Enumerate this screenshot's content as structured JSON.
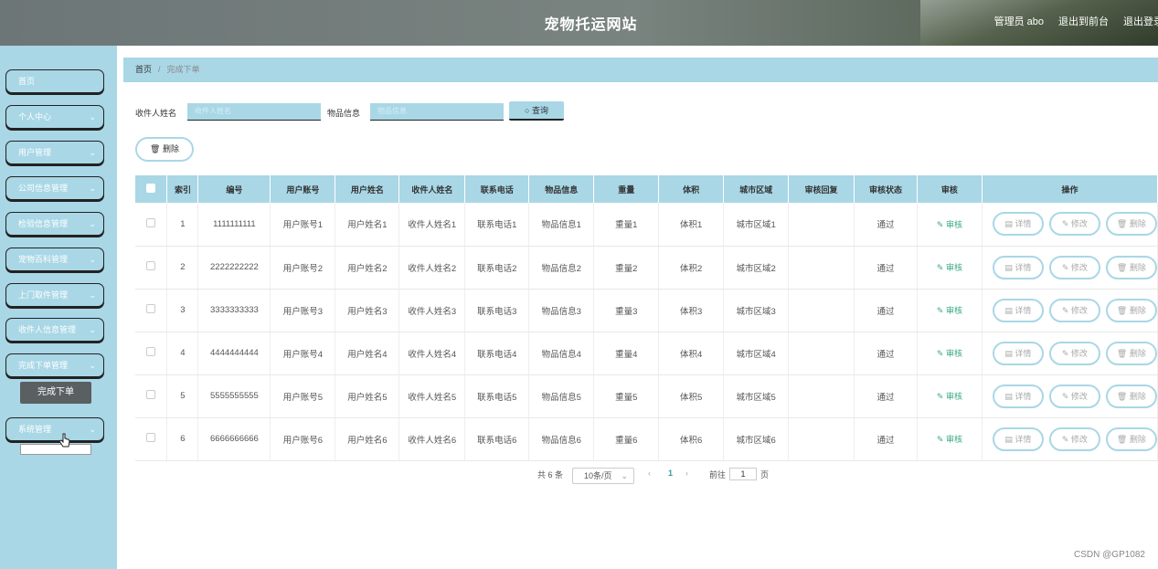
{
  "header": {
    "title": "宠物托运网站",
    "admin_label": "管理员 abo",
    "back_label": "退出到前台",
    "logout_label": "退出登录"
  },
  "sidebar": {
    "items": [
      {
        "label": "首页",
        "has_arrow": false
      },
      {
        "label": "个人中心",
        "has_arrow": true
      },
      {
        "label": "用户管理",
        "has_arrow": true
      },
      {
        "label": "公司信息管理",
        "has_arrow": true
      },
      {
        "label": "检验信息管理",
        "has_arrow": true
      },
      {
        "label": "宠物百科管理",
        "has_arrow": true
      },
      {
        "label": "上门取件管理",
        "has_arrow": true
      },
      {
        "label": "收件人信息管理",
        "has_arrow": true
      },
      {
        "label": "完成下单管理",
        "has_arrow": true
      },
      {
        "label": "系统管理",
        "has_arrow": true
      }
    ],
    "active_sub": "完成下单"
  },
  "breadcrumb": {
    "home": "首页",
    "current": "完成下单"
  },
  "search": {
    "receiver_label": "收件人姓名",
    "receiver_placeholder": "收件人姓名",
    "goods_label": "物品信息",
    "goods_placeholder": "物品信息",
    "query_label": "查询"
  },
  "actions": {
    "delete_label": "删除"
  },
  "table": {
    "columns": [
      "索引",
      "编号",
      "用户账号",
      "用户姓名",
      "收件人姓名",
      "联系电话",
      "物品信息",
      "重量",
      "体积",
      "城市区域",
      "审核回复",
      "审核状态",
      "审核",
      "操作"
    ],
    "rows": [
      {
        "index": "1",
        "code": "1111111111",
        "account": "用户账号1",
        "name": "用户姓名1",
        "receiver": "收件人姓名1",
        "phone": "联系电话1",
        "goods": "物品信息1",
        "weight": "重量1",
        "volume": "体积1",
        "area": "城市区域1",
        "reply": "",
        "status": "通过"
      },
      {
        "index": "2",
        "code": "2222222222",
        "account": "用户账号2",
        "name": "用户姓名2",
        "receiver": "收件人姓名2",
        "phone": "联系电话2",
        "goods": "物品信息2",
        "weight": "重量2",
        "volume": "体积2",
        "area": "城市区域2",
        "reply": "",
        "status": "通过"
      },
      {
        "index": "3",
        "code": "3333333333",
        "account": "用户账号3",
        "name": "用户姓名3",
        "receiver": "收件人姓名3",
        "phone": "联系电话3",
        "goods": "物品信息3",
        "weight": "重量3",
        "volume": "体积3",
        "area": "城市区域3",
        "reply": "",
        "status": "通过"
      },
      {
        "index": "4",
        "code": "4444444444",
        "account": "用户账号4",
        "name": "用户姓名4",
        "receiver": "收件人姓名4",
        "phone": "联系电话4",
        "goods": "物品信息4",
        "weight": "重量4",
        "volume": "体积4",
        "area": "城市区域4",
        "reply": "",
        "status": "通过"
      },
      {
        "index": "5",
        "code": "5555555555",
        "account": "用户账号5",
        "name": "用户姓名5",
        "receiver": "收件人姓名5",
        "phone": "联系电话5",
        "goods": "物品信息5",
        "weight": "重量5",
        "volume": "体积5",
        "area": "城市区域5",
        "reply": "",
        "status": "通过"
      },
      {
        "index": "6",
        "code": "6666666666",
        "account": "用户账号6",
        "name": "用户姓名6",
        "receiver": "收件人姓名6",
        "phone": "联系电话6",
        "goods": "物品信息6",
        "weight": "重量6",
        "volume": "体积6",
        "area": "城市区域6",
        "reply": "",
        "status": "通过"
      }
    ],
    "audit_label": "审核",
    "op_labels": {
      "detail": "详情",
      "edit": "修改",
      "delete": "删除"
    }
  },
  "pagination": {
    "total_text": "共 6 条",
    "page_size": "10条/页",
    "current_page": "1",
    "goto_label": "前往",
    "goto_value": "1",
    "page_suffix": "页"
  },
  "watermark": "CSDN @GP1082",
  "colors": {
    "accent": "#a9d7e6",
    "header": "#717b7a",
    "active_sub": "#5a5f61",
    "audit_link": "#3aa886"
  }
}
